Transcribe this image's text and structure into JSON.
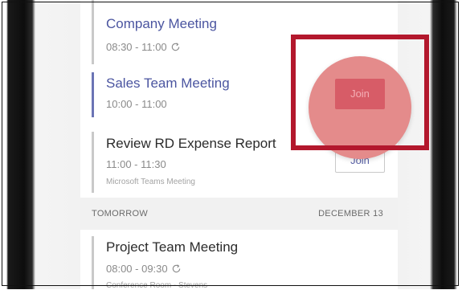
{
  "events": [
    {
      "title": "Company Meeting",
      "time": "08:30 - 11:00",
      "recurring": true
    },
    {
      "title": "Sales Team Meeting",
      "time": "10:00 - 11:00",
      "join_label": "Join"
    },
    {
      "title": "Review RD Expense Report",
      "time": "11:00 - 11:30",
      "location": "Microsoft Teams Meeting",
      "join_label": "Join"
    }
  ],
  "section": {
    "label": "TOMORROW",
    "date": "DECEMBER 13"
  },
  "tomorrow_events": [
    {
      "title": "Project Team Meeting",
      "time": "08:00 - 09:30",
      "location": "Conference Room - Stevens",
      "recurring": true
    }
  ],
  "colors": {
    "accent": "#4b55a0",
    "highlight_box": "#b3182d",
    "highlight_circle": "#e48b8b",
    "join_button_highlighted": "#d75c67"
  },
  "icons": {
    "recurring": "sync-icon"
  }
}
